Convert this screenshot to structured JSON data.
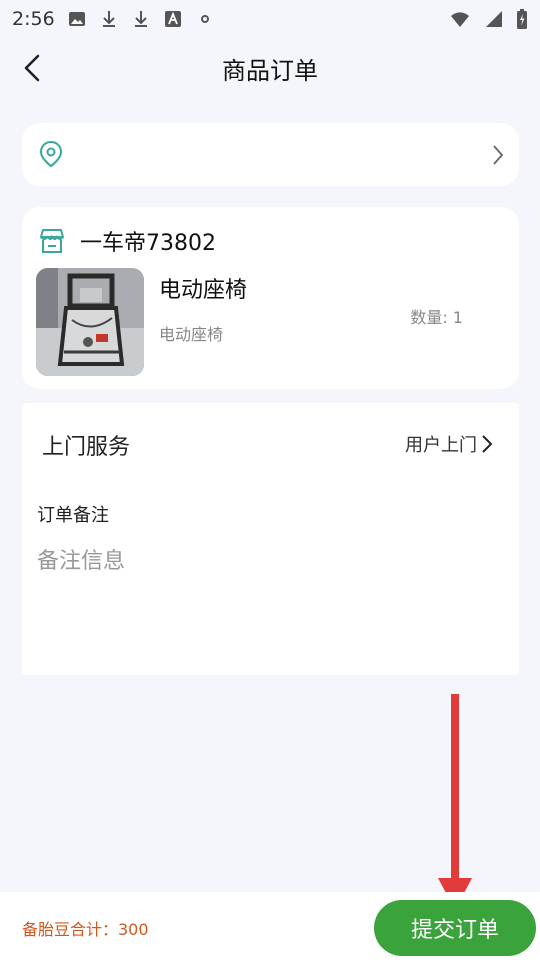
{
  "status_bar": {
    "time": "2:56",
    "icons": [
      "image-icon",
      "download-icon",
      "download-icon",
      "text-a-icon",
      "dot-icon"
    ],
    "right_icons": [
      "wifi-icon",
      "signal-icon",
      "battery-icon"
    ]
  },
  "header": {
    "title": "商品订单",
    "back_icon": "chevron-left-icon"
  },
  "address": {
    "icon": "location-pin-icon",
    "chevron": "chevron-right-icon"
  },
  "shop": {
    "name": "一车帝73802",
    "icon": "store-icon",
    "product": {
      "name": "电动座椅",
      "spec": "电动座椅",
      "quantity": "数量: 1",
      "image": "electric-seat-frame-photo"
    }
  },
  "service": {
    "label": "上门服务",
    "value": "用户上门",
    "note_label": "订单备注",
    "note_placeholder": "备注信息",
    "note_value": ""
  },
  "footer": {
    "total": "备胎豆合计：300",
    "submit_label": "提交订单"
  },
  "colors": {
    "accent_green": "#3aa33c",
    "total_orange": "#d2581e",
    "annotation_red": "#e23b3b",
    "pin_teal": "#3aa89a"
  }
}
